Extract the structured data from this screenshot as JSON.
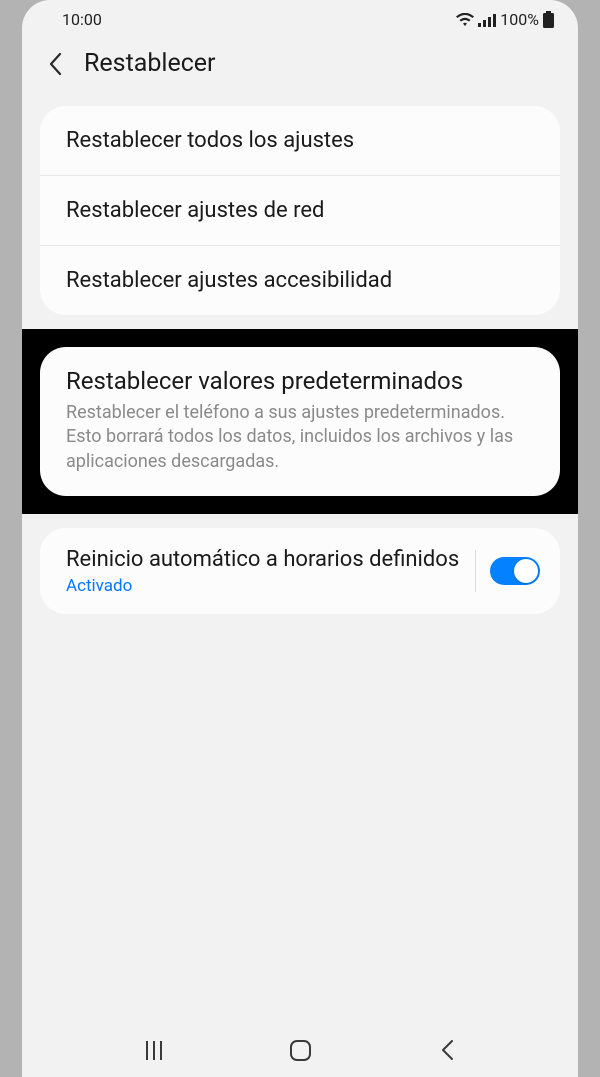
{
  "status_bar": {
    "time": "10:00",
    "battery_pct": "100%"
  },
  "header": {
    "title": "Restablecer"
  },
  "reset_options": {
    "item1": "Restablecer todos los ajustes",
    "item2": "Restablecer ajustes de red",
    "item3": "Restablecer ajustes accesibilidad"
  },
  "factory_reset": {
    "title": "Restablecer valores predeterminados",
    "description": "Restablecer el teléfono a sus ajustes predeterminados. Esto borrará todos los datos, incluidos los archivos y las aplicaciones descargadas."
  },
  "auto_restart": {
    "title": "Reinicio automático a horarios definidos",
    "status": "Activado",
    "enabled": true
  }
}
